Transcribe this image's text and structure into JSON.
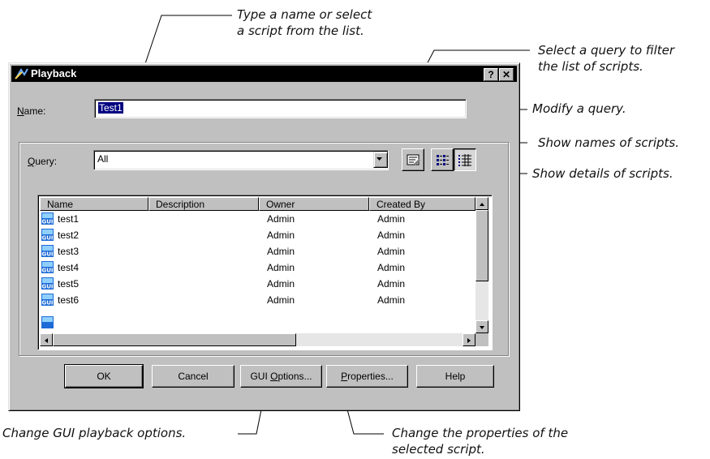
{
  "callouts": {
    "type_name": "Type a name or select\na script from the list.",
    "select_query": "Select a query to filter\nthe list of scripts.",
    "modify_query": "Modify a query.",
    "show_names": "Show names of scripts.",
    "show_details": "Show details of scripts.",
    "gui_options": "Change GUI playback options.",
    "properties": "Change the properties of the\nselected script."
  },
  "window": {
    "title": "Playback",
    "help_button": "?",
    "close_button": "✕"
  },
  "name_field": {
    "label_accel": "N",
    "label_rest": "ame:",
    "value": "Test1"
  },
  "query_field": {
    "label_accel": "Q",
    "label_rest": "uery:",
    "value": "All"
  },
  "list": {
    "columns": [
      "Name",
      "Description",
      "Owner",
      "Created By"
    ],
    "rows": [
      {
        "name": "test1",
        "description": "",
        "owner": "Admin",
        "created_by": "Admin"
      },
      {
        "name": "test2",
        "description": "",
        "owner": "Admin",
        "created_by": "Admin"
      },
      {
        "name": "test3",
        "description": "",
        "owner": "Admin",
        "created_by": "Admin"
      },
      {
        "name": "test4",
        "description": "",
        "owner": "Admin",
        "created_by": "Admin"
      },
      {
        "name": "test5",
        "description": "",
        "owner": "Admin",
        "created_by": "Admin"
      },
      {
        "name": "test6",
        "description": "",
        "owner": "Admin",
        "created_by": "Admin"
      }
    ],
    "row_icon": "gui-script-icon"
  },
  "buttons": {
    "ok": "OK",
    "cancel": "Cancel",
    "gui_options_pre": "GUI ",
    "gui_options_accel": "O",
    "gui_options_post": "ptions...",
    "properties_accel": "P",
    "properties_post": "roperties...",
    "help": "Help"
  },
  "colors": {
    "title_bar": "#000000",
    "dialog_face": "#c0c0c0",
    "selection": "#000080"
  }
}
